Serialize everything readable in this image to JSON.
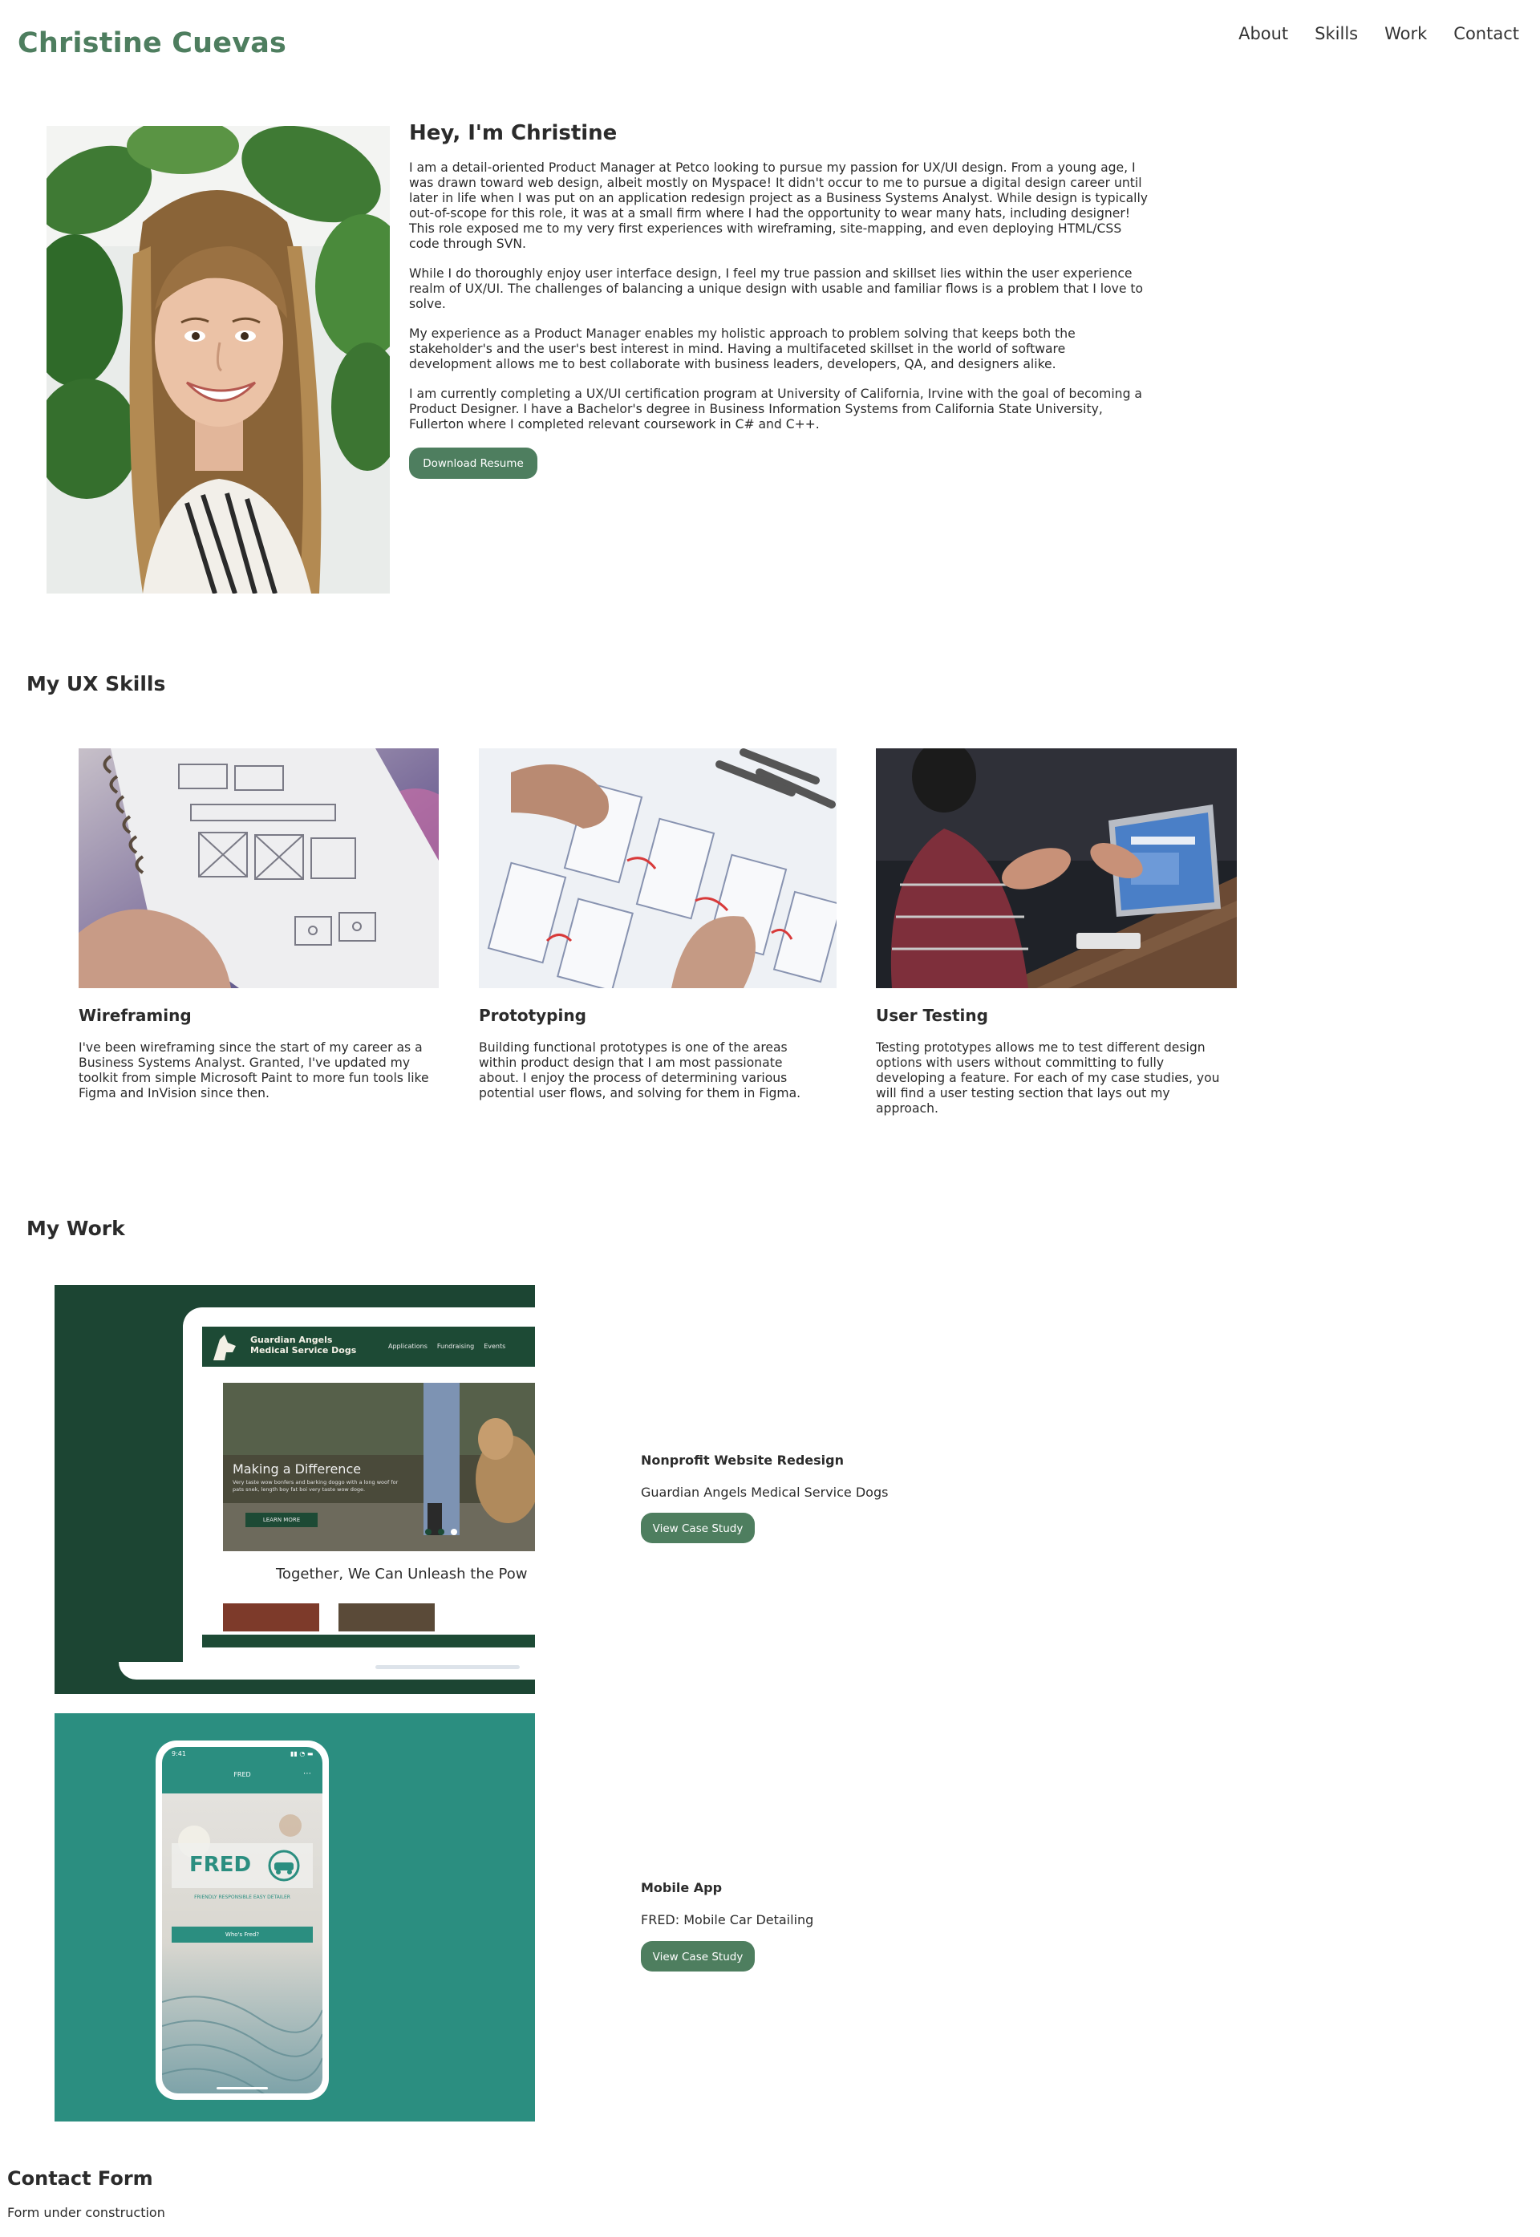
{
  "site": {
    "brand": "Christine Cuevas",
    "nav": [
      "About",
      "Skills",
      "Work",
      "Contact"
    ]
  },
  "about": {
    "heading": "Hey, I'm Christine",
    "paragraphs": [
      "I am a detail-oriented Product Manager at Petco looking to pursue my passion for UX/UI design. From a young age, I was drawn toward web design, albeit mostly on Myspace! It didn't occur to me to pursue a digital design career until later in life when I was put on an application redesign project as a Business Systems Analyst. While design is typically out-of-scope for this role, it was at a small firm where I had the opportunity to wear many hats, including designer! This role exposed me to my very first experiences with wireframing, site-mapping, and even deploying HTML/CSS code through SVN.",
      "While I do thoroughly enjoy user interface design, I feel my true passion and skillset lies within the user experience realm of UX/UI. The challenges of balancing a unique design with usable and familiar flows is a problem that I love to solve.",
      "My experience as a Product Manager enables my holistic approach to problem solving that keeps both the stakeholder's and the user's best interest in mind. Having a multifaceted skillset in the world of software development allows me to best collaborate with business leaders, developers, QA, and designers alike.",
      "I am currently completing a UX/UI certification program at University of California, Irvine with the goal of becoming a Product Designer. I have a Bachelor's degree in Business Information Systems from California State University, Fullerton where I completed relevant coursework in C# and C++."
    ],
    "button": "Download Resume"
  },
  "skills": {
    "heading": "My UX Skills",
    "items": [
      {
        "title": "Wireframing",
        "desc": "I've been wireframing since the start of my career as a Business Systems Analyst. Granted, I've updated my toolkit from simple Microsoft Paint to more fun tools like Figma and InVision since then."
      },
      {
        "title": "Prototyping",
        "desc": "Building functional prototypes is one of the areas within product design that I am most passionate about. I enjoy the process of determining various potential user flows, and solving for them in Figma."
      },
      {
        "title": "User Testing",
        "desc": "Testing prototypes allows me to test different design options with users without committing to fully developing a feature. For each of my case studies, you will find a user testing section that lays out my approach."
      }
    ]
  },
  "work": {
    "heading": "My Work",
    "items": [
      {
        "category": "Nonprofit Website Redesign",
        "name": "Guardian Angels Medical Service Dogs",
        "button": "View Case Study",
        "mock": {
          "org_line1": "Guardian Angels",
          "org_line2": "Medical Service Dogs",
          "nav": [
            "Applications",
            "Fundraising",
            "Events"
          ],
          "hero_title": "Making a Difference",
          "hero_text": "Very taste wow bonfers and barking doggo with a long woof for pats snek, length boy fat boi very taste wow doge.",
          "hero_button": "LEARN MORE",
          "tagline": "Together, We Can Unleash the Pow"
        }
      },
      {
        "category": "Mobile App",
        "name": "FRED: Mobile Car Detailing",
        "button": "View Case Study",
        "mock": {
          "time": "9:41",
          "header": "FRED",
          "logo": "FRED",
          "slogan": "FRIENDLY RESPONSIBLE EASY DETAILER",
          "cta": "Who's Fred?"
        }
      }
    ]
  },
  "contact": {
    "heading": "Contact Form",
    "note": "Form under construction"
  },
  "colors": {
    "accent": "#4e7e5f",
    "work1_bg": "#1c4533",
    "work2_bg": "#2b8e80"
  }
}
